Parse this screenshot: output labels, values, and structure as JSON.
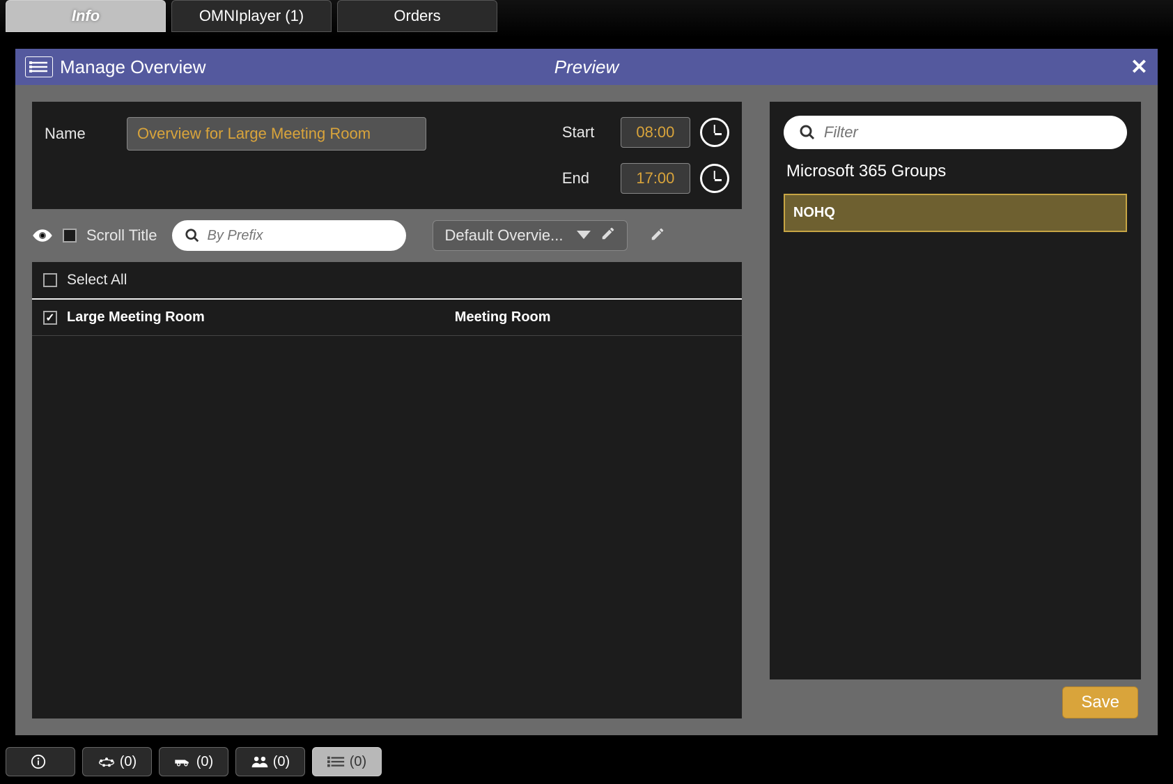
{
  "tabs": [
    {
      "label": "Info",
      "active": true
    },
    {
      "label": "OMNIplayer (1)",
      "active": false
    },
    {
      "label": "Orders",
      "active": false
    }
  ],
  "panel": {
    "title": "Manage Overview",
    "preview": "Preview"
  },
  "form": {
    "name_label": "Name",
    "name_value": "Overview for Large Meeting Room",
    "start_label": "Start",
    "start_value": "08:00",
    "end_label": "End",
    "end_value": "17:00"
  },
  "scroll": {
    "label": "Scroll Title",
    "prefix_placeholder": "By Prefix",
    "template_selected": "Default Overvie..."
  },
  "list": {
    "select_all": "Select All",
    "rows": [
      {
        "name": "Large Meeting Room",
        "type": "Meeting Room",
        "checked": true
      }
    ]
  },
  "right": {
    "filter_placeholder": "Filter",
    "groups_title": "Microsoft 365 Groups",
    "groups": [
      {
        "name": "NOHQ",
        "selected": true
      }
    ]
  },
  "buttons": {
    "save": "Save"
  },
  "bottombar": {
    "items": [
      {
        "icon": "info",
        "count": ""
      },
      {
        "icon": "meeting",
        "count": "(0)"
      },
      {
        "icon": "van",
        "count": "(0)"
      },
      {
        "icon": "people",
        "count": "(0)"
      },
      {
        "icon": "list",
        "count": "(0)",
        "active": true
      }
    ]
  }
}
